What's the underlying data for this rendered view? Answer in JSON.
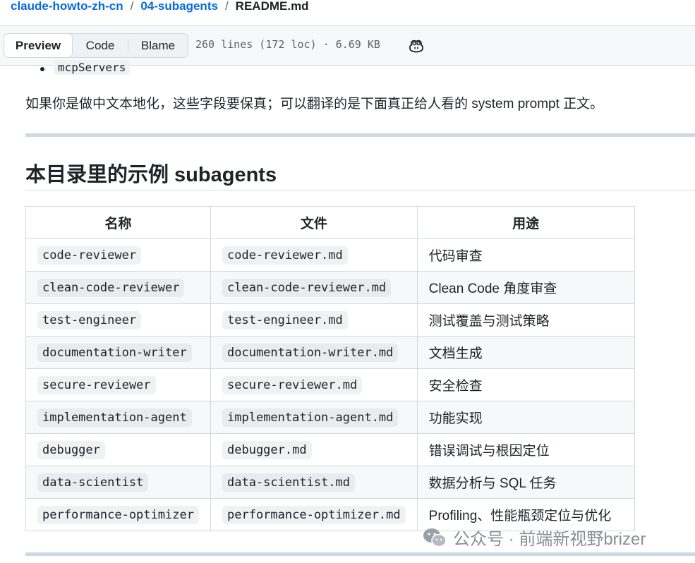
{
  "breadcrumb": {
    "repo": "claude-howto-zh-cn",
    "folder": "04-subagents",
    "file": "README.md",
    "separator": "/"
  },
  "toolbar": {
    "tabs": [
      {
        "label": "Preview",
        "active": true
      },
      {
        "label": "Code",
        "active": false
      },
      {
        "label": "Blame",
        "active": false
      }
    ],
    "file_meta": "260 lines (172 loc) · 6.69 KB",
    "copilot_icon": "copilot-icon"
  },
  "content": {
    "partial_bullet": "mcpServers",
    "note": "如果你是做中文本地化，这些字段要保真；可以翻译的是下面真正给人看的 system prompt 正文。",
    "heading": "本目录里的示例 subagents"
  },
  "table": {
    "headers": [
      "名称",
      "文件",
      "用途"
    ],
    "rows": [
      {
        "name": "code-reviewer",
        "file": "code-reviewer.md",
        "purpose": "代码审查"
      },
      {
        "name": "clean-code-reviewer",
        "file": "clean-code-reviewer.md",
        "purpose": "Clean Code 角度审查"
      },
      {
        "name": "test-engineer",
        "file": "test-engineer.md",
        "purpose": "测试覆盖与测试策略"
      },
      {
        "name": "documentation-writer",
        "file": "documentation-writer.md",
        "purpose": "文档生成"
      },
      {
        "name": "secure-reviewer",
        "file": "secure-reviewer.md",
        "purpose": "安全检查"
      },
      {
        "name": "implementation-agent",
        "file": "implementation-agent.md",
        "purpose": "功能实现"
      },
      {
        "name": "debugger",
        "file": "debugger.md",
        "purpose": "错误调试与根因定位"
      },
      {
        "name": "data-scientist",
        "file": "data-scientist.md",
        "purpose": "数据分析与 SQL 任务"
      },
      {
        "name": "performance-optimizer",
        "file": "performance-optimizer.md",
        "purpose": "Profiling、性能瓶颈定位与优化"
      }
    ]
  },
  "watermark": {
    "text": "公众号 · 前端新视野brizer",
    "icon": "wechat-icon"
  },
  "colors": {
    "link": "#0969da",
    "text": "#1f2328",
    "muted": "#59636e",
    "border": "#d1d9e0",
    "code_bg": "#eff1f3"
  }
}
